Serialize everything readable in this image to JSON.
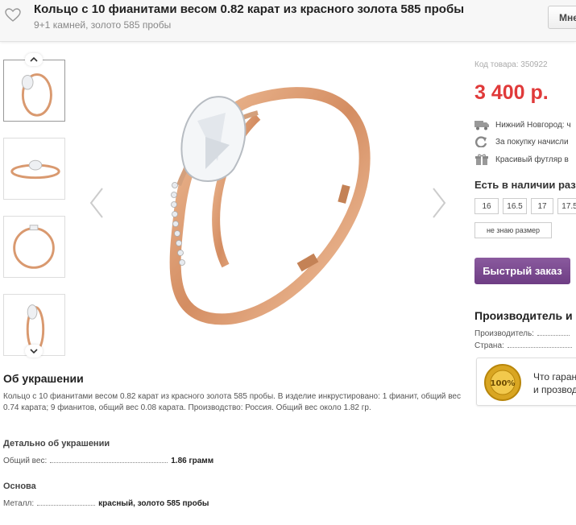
{
  "header": {
    "title": "Кольцо с 10 фианитами весом 0.82 карат из красного золота 585 пробы",
    "subtitle": "9+1 камней, золото 585 пробы",
    "button_label": "Мне"
  },
  "product": {
    "about_heading": "Об украшении",
    "about_text": "Кольцо с 10 фианитами весом 0.82 карат из красного золота 585 пробы. В изделие инкрустировано: 1 фианит, общий вес 0.74 карата; 9 фианитов, общий вес 0.08 карата. Производство: Россия. Общий вес около 1.82 гр.",
    "details_heading": "Детально об украшении",
    "weight_label": "Общий вес:",
    "weight_value": "1.86 грамм",
    "base_heading": "Основа",
    "metal_label": "Металл:",
    "metal_value": "красный, золото 585 пробы"
  },
  "sidebar": {
    "sku": "Код товара: 350922",
    "price": "3 400 р.",
    "features": [
      {
        "icon": "truck-icon",
        "text": "Нижний Новгород: ч"
      },
      {
        "icon": "refresh-icon",
        "text": "За покупку начисли"
      },
      {
        "icon": "gift-icon",
        "text": "Красивый футляр в"
      }
    ],
    "stock_heading": "Есть в наличии раз",
    "sizes": [
      "16",
      "16.5",
      "17",
      "17.5"
    ],
    "no_size_label": "не знаю размер",
    "quick_order_label": "Быстрый заказ",
    "maker_heading": "Производитель и",
    "maker_label": "Производитель:",
    "country_label": "Страна:",
    "guarantee_badge": "100%",
    "guarantee_line1": "Что гаран",
    "guarantee_line2": "и прозвод"
  },
  "colors": {
    "price": "#e03a3a",
    "quick_order": "#7a4a90",
    "gold": "#d9996f"
  }
}
